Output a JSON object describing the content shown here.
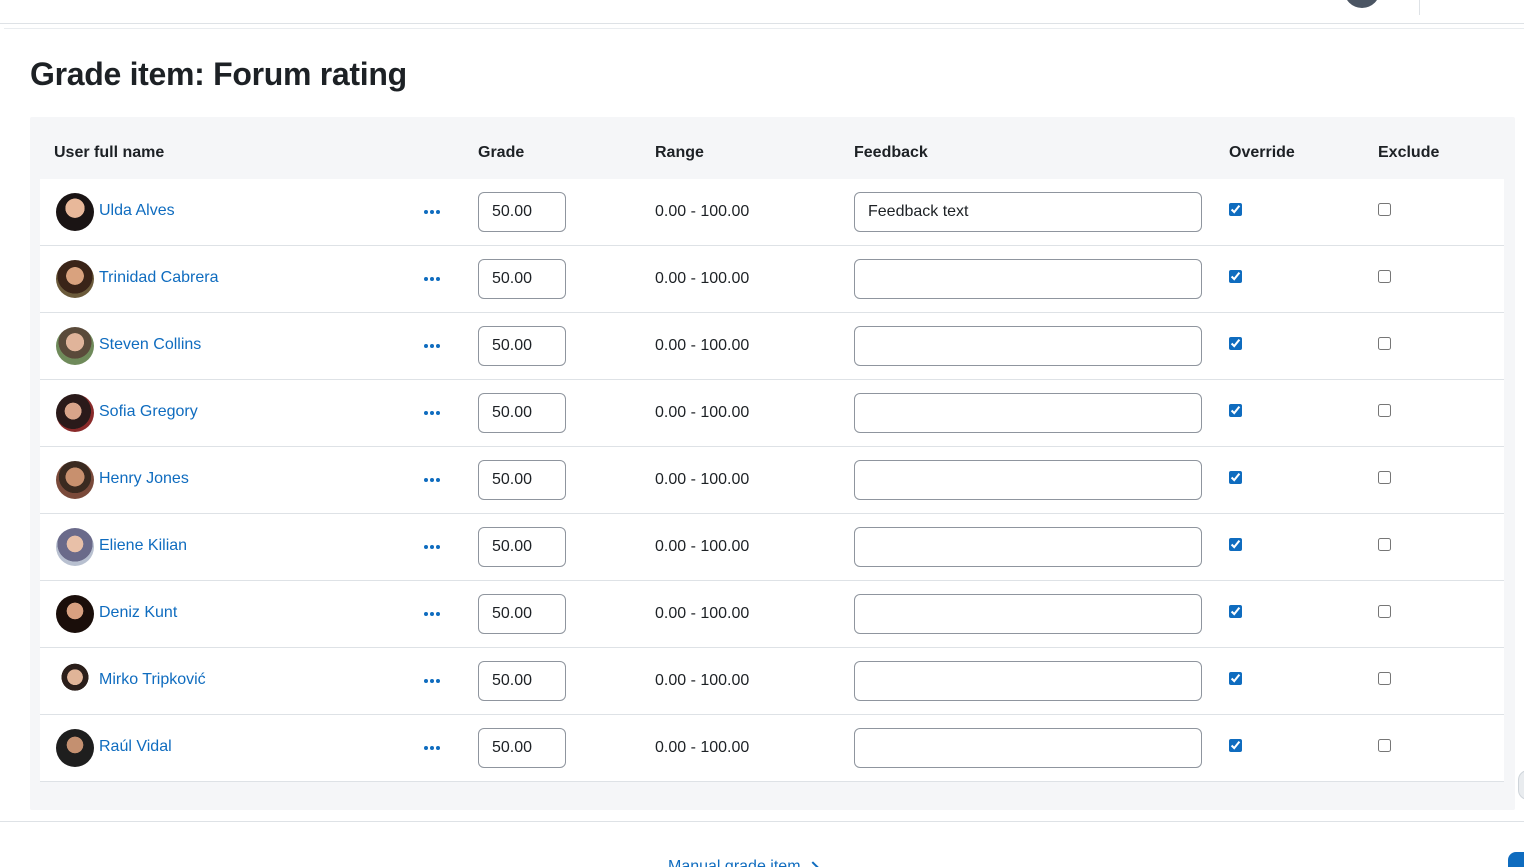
{
  "page": {
    "title": "Grade item: Forum rating"
  },
  "table": {
    "headers": {
      "name": "User full name",
      "grade": "Grade",
      "range": "Range",
      "feedback": "Feedback",
      "override": "Override",
      "exclude": "Exclude"
    },
    "rows": [
      {
        "name": "Ulda Alves",
        "grade": "50.00",
        "range": "0.00 - 100.00",
        "feedback": "Feedback text",
        "override": true,
        "exclude": false,
        "avatar": "portrait-woman-black-hair"
      },
      {
        "name": "Trinidad Cabrera",
        "grade": "50.00",
        "range": "0.00 - 100.00",
        "feedback": "",
        "override": true,
        "exclude": false,
        "avatar": "portrait-woman-dark-hair"
      },
      {
        "name": "Steven Collins",
        "grade": "50.00",
        "range": "0.00 - 100.00",
        "feedback": "",
        "override": true,
        "exclude": false,
        "avatar": "portrait-man-outdoors"
      },
      {
        "name": "Sofia Gregory",
        "grade": "50.00",
        "range": "0.00 - 100.00",
        "feedback": "",
        "override": true,
        "exclude": false,
        "avatar": "portrait-woman-red"
      },
      {
        "name": "Henry Jones",
        "grade": "50.00",
        "range": "0.00 - 100.00",
        "feedback": "",
        "override": true,
        "exclude": false,
        "avatar": "portrait-man-smiling"
      },
      {
        "name": "Eliene Kilian",
        "grade": "50.00",
        "range": "0.00 - 100.00",
        "feedback": "",
        "override": true,
        "exclude": false,
        "avatar": "portrait-woman-glasses"
      },
      {
        "name": "Deniz Kunt",
        "grade": "50.00",
        "range": "0.00 - 100.00",
        "feedback": "",
        "override": true,
        "exclude": false,
        "avatar": "portrait-woman-dark"
      },
      {
        "name": "Mirko Tripković",
        "grade": "50.00",
        "range": "0.00 - 100.00",
        "feedback": "",
        "override": true,
        "exclude": false,
        "avatar": "portrait-man-beard"
      },
      {
        "name": "Raúl Vidal",
        "grade": "50.00",
        "range": "0.00 - 100.00",
        "feedback": "",
        "override": true,
        "exclude": false,
        "avatar": "portrait-man-dark"
      }
    ]
  },
  "footer": {
    "next_link": "Manual grade item"
  },
  "colors": {
    "link": "#0f6cbf",
    "panel": "#f5f6f8",
    "border": "#8f959e"
  },
  "icons": {
    "actions": "more-horizontal-icon",
    "next": "chevron-right-icon"
  }
}
